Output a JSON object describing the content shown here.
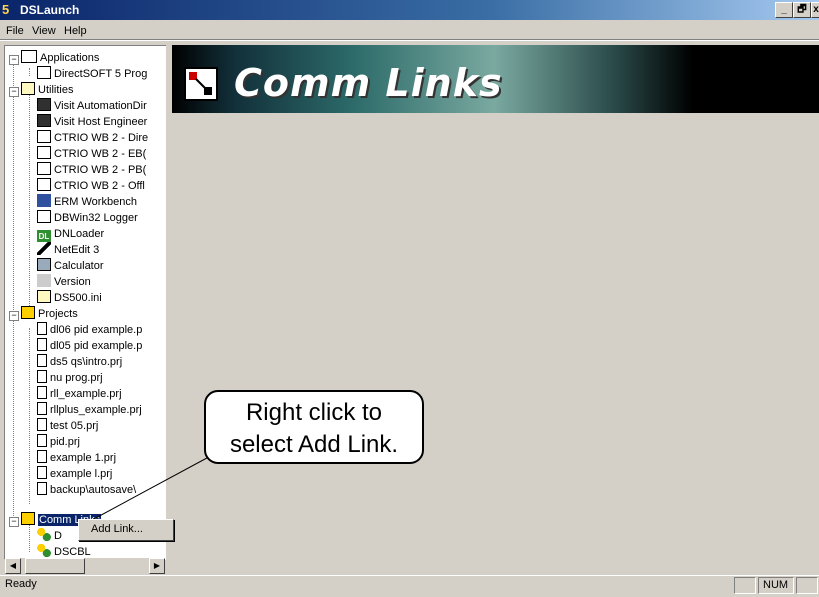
{
  "window": {
    "title": "DSLaunch",
    "caption_buttons": [
      "_",
      "🗗",
      "x"
    ]
  },
  "menu": [
    "File",
    "View",
    "Help"
  ],
  "tree": {
    "applications": {
      "label": "Applications",
      "items": [
        "DirectSOFT 5 Prog"
      ]
    },
    "utilities": {
      "label": "Utilities",
      "items": [
        "Visit AutomationDir",
        "Visit Host Engineer",
        "CTRIO WB 2 - Dire",
        "CTRIO WB 2 - EB(",
        "CTRIO WB 2 - PB(",
        "CTRIO WB 2 - Offl",
        "ERM Workbench",
        "DBWin32 Logger",
        "DNLoader",
        "NetEdit 3",
        "Calculator",
        "Version",
        "DS500.ini"
      ]
    },
    "projects": {
      "label": "Projects",
      "items": [
        "dl06 pid example.p",
        "dl05 pid example.p",
        "ds5 qs\\intro.prj",
        "nu prog.prj",
        "rll_example.prj",
        "rllplus_example.prj",
        "test 05.prj",
        "pid.prj",
        "example 1.prj",
        "example l.prj",
        "backup\\autosave\\"
      ]
    },
    "comm_links": {
      "label": "Comm Links",
      "items": [
        "D",
        "DSCBL"
      ]
    }
  },
  "banner": {
    "title": "Comm Links"
  },
  "context_menu": {
    "items": [
      "Add Link..."
    ]
  },
  "callout": {
    "line1": "Right click to",
    "line2": "select Add Link."
  },
  "statusbar": {
    "text": "Ready",
    "panels": [
      "",
      "NUM",
      ""
    ]
  }
}
